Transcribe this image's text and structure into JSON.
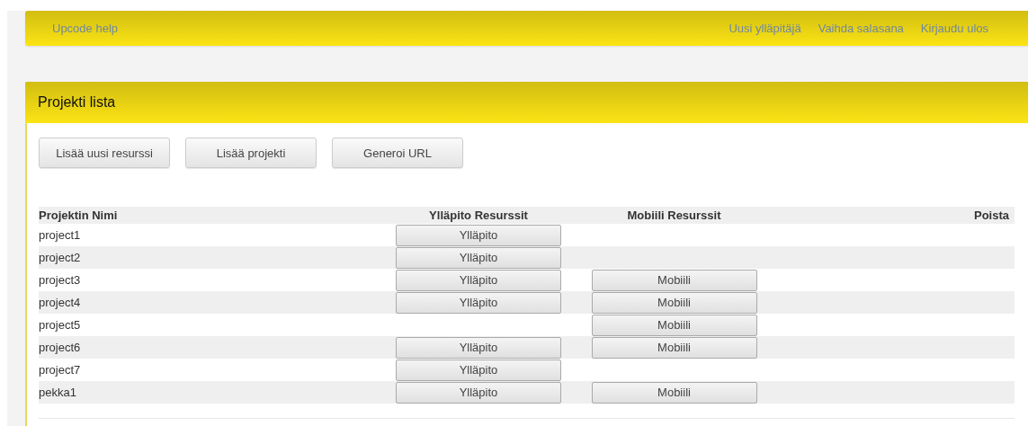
{
  "navbar": {
    "brand": "Upcode help",
    "links": [
      "Uusi ylläpitäjä",
      "Vaihda salasana",
      "Kirjaudu ulos"
    ]
  },
  "panel": {
    "title": "Projekti lista",
    "buttons": [
      "Lisää uusi resurssi",
      "Lisää projekti",
      "Generoi URL"
    ]
  },
  "table": {
    "columns": [
      "Projektin Nimi",
      "Ylläpito Resurssit",
      "Mobiili Resurssit",
      "Poista"
    ],
    "rows": [
      {
        "name": "project1",
        "admin_button": "Ylläpito"
      },
      {
        "name": "project2",
        "admin_button": "Ylläpito"
      },
      {
        "name": "project3",
        "admin_button": "Ylläpito",
        "mobile_button": "Mobiili"
      },
      {
        "name": "project4",
        "admin_button": "Ylläpito",
        "mobile_button": "Mobiili"
      },
      {
        "name": "project5",
        "mobile_button": "Mobiili"
      },
      {
        "name": "project6",
        "admin_button": "Ylläpito",
        "mobile_button": "Mobiili"
      },
      {
        "name": "project7",
        "admin_button": "Ylläpito"
      },
      {
        "name": "pekka1",
        "admin_button": "Ylläpito",
        "mobile_button": "Mobiili"
      }
    ]
  }
}
